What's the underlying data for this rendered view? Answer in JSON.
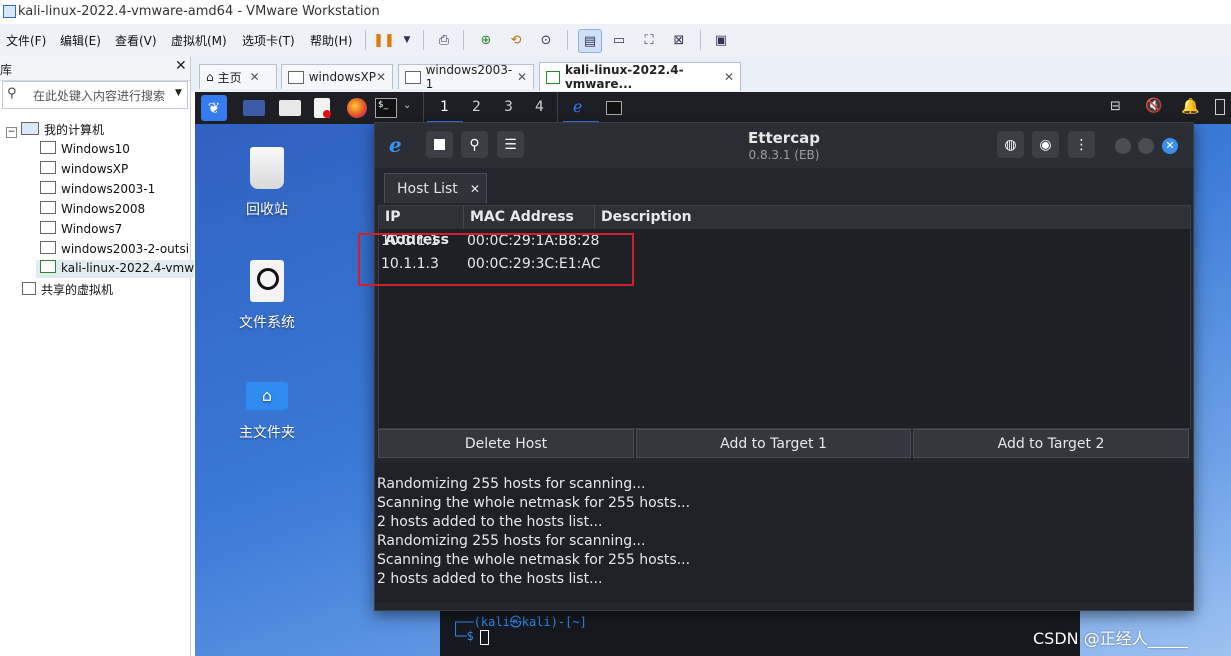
{
  "window": {
    "title": "kali-linux-2022.4-vmware-amd64 - VMware Workstation"
  },
  "menu": [
    "文件(F)",
    "编辑(E)",
    "查看(V)",
    "虚拟机(M)",
    "选项卡(T)",
    "帮助(H)"
  ],
  "library": {
    "title": "库",
    "search_placeholder": "在此处键入内容进行搜索",
    "root": "我的计算机",
    "vms": [
      "Windows10",
      "windowsXP",
      "windows2003-1",
      "Windows2008",
      "Windows7",
      "windows2003-2-outsid",
      "kali-linux-2022.4-vmw"
    ],
    "shared": "共享的虚拟机"
  },
  "tabs": [
    {
      "label": "主页",
      "active": false
    },
    {
      "label": "windowsXP",
      "active": false
    },
    {
      "label": "windows2003-1",
      "active": false
    },
    {
      "label": "kali-linux-2022.4-vmware...",
      "active": true
    }
  ],
  "panel": {
    "workspaces": [
      "1",
      "2",
      "3",
      "4"
    ]
  },
  "desktop": {
    "icons": [
      "回收站",
      "文件系统",
      "主文件夹"
    ]
  },
  "ettercap": {
    "title": "Ettercap",
    "version": "0.8.3.1 (EB)",
    "tab_label": "Host List",
    "columns": [
      "IP Address",
      "MAC Address",
      "Description"
    ],
    "hosts": [
      {
        "ip": "10.1.1.1",
        "mac": "00:0C:29:1A:B8:28",
        "desc": ""
      },
      {
        "ip": "10.1.1.3",
        "mac": "00:0C:29:3C:E1:AC",
        "desc": ""
      }
    ],
    "buttons": {
      "delete": "Delete Host",
      "target1": "Add to Target 1",
      "target2": "Add to Target 2"
    },
    "log": [
      "Randomizing 255 hosts for scanning...",
      "Scanning the whole netmask for 255 hosts...",
      "2 hosts added to the hosts list...",
      "Randomizing 255 hosts for scanning...",
      "Scanning the whole netmask for 255 hosts...",
      "2 hosts added to the hosts list..."
    ]
  },
  "terminal": {
    "line1": "┌──(kali㉿kali)-[~]",
    "line2": "└─$"
  },
  "watermark": "CSDN @正经人_____",
  "colors": {
    "highlight_box": "#d0212a",
    "ettercap_bg": "#23262c",
    "accent": "#3a79d6"
  }
}
